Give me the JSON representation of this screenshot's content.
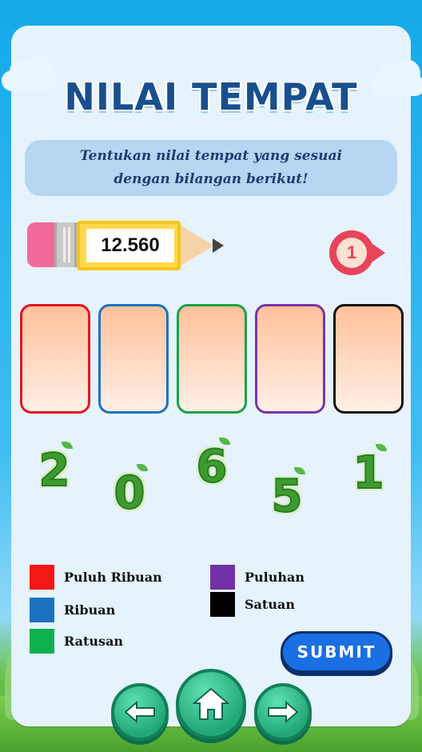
{
  "title": "NILAI TEMPAT",
  "instruction": "Tentukan nilai tempat yang sesuai dengan bilangan berikut!",
  "number": "12.560",
  "question_number": "1",
  "slots": [
    {
      "color": "#e3161f"
    },
    {
      "color": "#1b72c0"
    },
    {
      "color": "#18a34a"
    },
    {
      "color": "#7a34a8"
    },
    {
      "color": "#111111"
    }
  ],
  "digits": [
    "2",
    "0",
    "6",
    "5",
    "1"
  ],
  "legend": [
    {
      "label": "Puluh Ribuan",
      "color": "#f51616"
    },
    {
      "label": "Ribuan",
      "color": "#1b72c0"
    },
    {
      "label": "Ratusan",
      "color": "#0fb14f"
    },
    {
      "label": "Puluhan",
      "color": "#7031a6"
    },
    {
      "label": "Satuan",
      "color": "#000000"
    }
  ],
  "submit_label": "SUBMIT",
  "nav": {
    "back_icon": "arrow-left-icon",
    "home_icon": "home-icon",
    "next_icon": "arrow-right-icon"
  }
}
